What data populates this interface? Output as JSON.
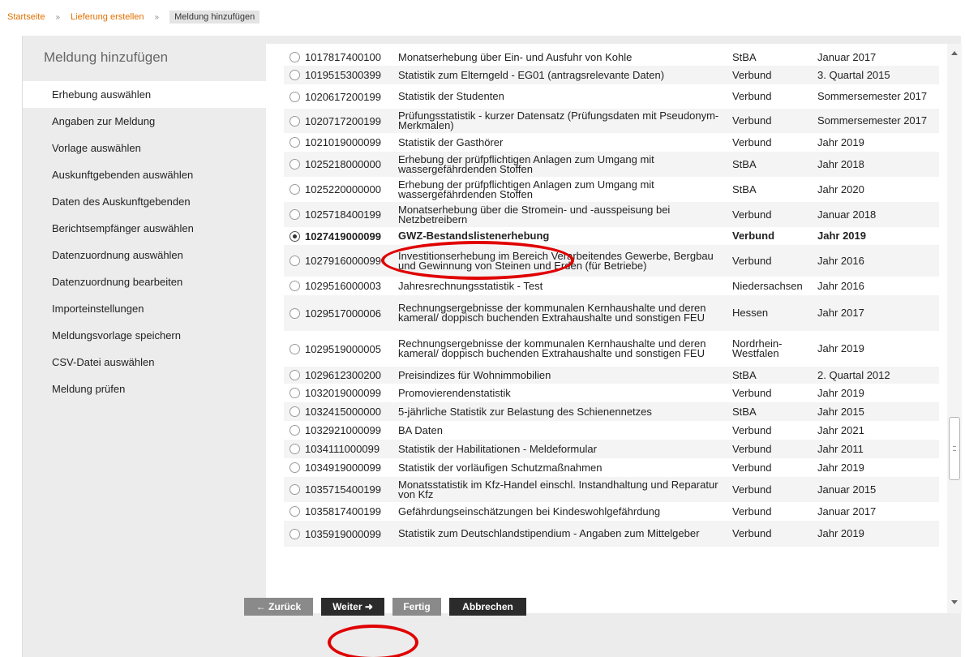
{
  "breadcrumb": {
    "home": "Startseite",
    "sep": "»",
    "parent": "Lieferung erstellen",
    "current": "Meldung hinzufügen"
  },
  "sidebar": {
    "title": "Meldung hinzufügen",
    "steps": [
      "Erhebung auswählen",
      "Angaben zur Meldung",
      "Vorlage auswählen",
      "Auskunftgebenden auswählen",
      "Daten des Auskunftgebenden",
      "Berichtsempfänger auswählen",
      "Datenzuordnung auswählen",
      "Datenzuordnung bearbeiten",
      "Importeinstellungen",
      "Meldungsvorlage speichern",
      "CSV-Datei auswählen",
      "Meldung prüfen"
    ]
  },
  "surveys": [
    {
      "code": "1017817400100",
      "name": "Monatserhebung über Ein- und Ausfuhr von Kohle",
      "agency": "StBA",
      "period": "Januar 2017"
    },
    {
      "code": "1019515300399",
      "name": "Statistik zum Elterngeld - EG01 (antragsrelevante Daten)",
      "agency": "Verbund",
      "period": "3. Quartal 2015"
    },
    {
      "code": "1020617200199",
      "name": "Statistik der Studenten",
      "agency": "Verbund",
      "period": "Sommersemester 2017"
    },
    {
      "code": "1020717200199",
      "name": "Prüfungsstatistik - kurzer Datensatz (Prüfungsdaten mit Pseudonym-Merkmalen)",
      "agency": "Verbund",
      "period": "Sommersemester 2017"
    },
    {
      "code": "1021019000099",
      "name": "Statistik der Gasthörer",
      "agency": "Verbund",
      "period": "Jahr 2019"
    },
    {
      "code": "1025218000000",
      "name": "Erhebung der prüfpflichtigen Anlagen zum Umgang mit wassergefährdenden Stoffen",
      "agency": "StBA",
      "period": "Jahr 2018"
    },
    {
      "code": "1025220000000",
      "name": "Erhebung der prüfpflichtigen Anlagen zum Umgang mit wassergefährdenden Stoffen",
      "agency": "StBA",
      "period": "Jahr 2020"
    },
    {
      "code": "1025718400199",
      "name": "Monatserhebung über die Stromein- und -ausspeisung bei Netzbetreibern",
      "agency": "Verbund",
      "period": "Januar 2018"
    },
    {
      "code": "1027419000099",
      "name": "GWZ-Bestandslistenerhebung",
      "agency": "Verbund",
      "period": "Jahr 2019",
      "selected": true
    },
    {
      "code": "1027916000099",
      "name": "Investitionserhebung im Bereich Verarbeitendes Gewerbe, Bergbau und Gewinnung von Steinen und Erden (für Betriebe)",
      "agency": "Verbund",
      "period": "Jahr 2016"
    },
    {
      "code": "1029516000003",
      "name": "Jahresrechnungsstatistik - Test",
      "agency": "Niedersachsen",
      "period": "Jahr 2016"
    },
    {
      "code": "1029517000006",
      "name": "Rechnungsergebnisse der kommunalen Kernhaushalte und deren kameral/ doppisch buchenden Extrahaushalte und sonstigen FEU",
      "agency": "Hessen",
      "period": "Jahr 2017"
    },
    {
      "code": "1029519000005",
      "name": "Rechnungsergebnisse der kommunalen Kernhaushalte und deren kameral/ doppisch buchenden Extrahaushalte und sonstigen FEU",
      "agency": "Nordrhein-Westfalen",
      "period": "Jahr 2019"
    },
    {
      "code": "1029612300200",
      "name": "Preisindizes für Wohnimmobilien",
      "agency": "StBA",
      "period": "2. Quartal 2012"
    },
    {
      "code": "1032019000099",
      "name": "Promovierendenstatistik",
      "agency": "Verbund",
      "period": "Jahr 2019"
    },
    {
      "code": "1032415000000",
      "name": "5-jährliche Statistik zur Belastung des Schienennetzes",
      "agency": "StBA",
      "period": "Jahr 2015"
    },
    {
      "code": "1032921000099",
      "name": "BA Daten",
      "agency": "Verbund",
      "period": "Jahr 2021"
    },
    {
      "code": "1034111000099",
      "name": "Statistik der Habilitationen - Meldeformular",
      "agency": "Verbund",
      "period": "Jahr 2011"
    },
    {
      "code": "1034919000099",
      "name": "Statistik der vorläufigen Schutzmaßnahmen",
      "agency": "Verbund",
      "period": "Jahr 2019"
    },
    {
      "code": "1035715400199",
      "name": "Monatsstatistik im Kfz-Handel einschl. Instandhaltung und Reparatur von Kfz",
      "agency": "Verbund",
      "period": "Januar 2015"
    },
    {
      "code": "1035817400199",
      "name": "Gefährdungseinschätzungen bei Kindeswohlgefährdung",
      "agency": "Verbund",
      "period": "Januar 2017"
    },
    {
      "code": "1035919000099",
      "name": "Statistik zum Deutschlandstipendium - Angaben zum Mittelgeber",
      "agency": "Verbund",
      "period": "Jahr 2019"
    }
  ],
  "buttons": {
    "back": "← Zurück",
    "next": "Weiter ➜",
    "finish": "Fertig",
    "cancel": "Abbrechen"
  },
  "colors": {
    "link": "#e07000",
    "annotation": "#e00000",
    "panel": "#ececec"
  }
}
